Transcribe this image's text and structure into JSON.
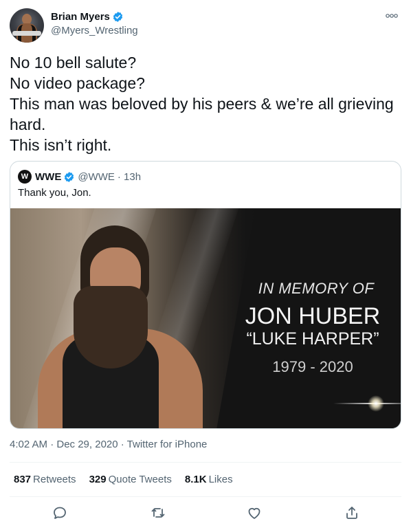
{
  "author": {
    "display_name": "Brian Myers",
    "handle": "@Myers_Wrestling"
  },
  "tweet": {
    "lines": [
      "No 10 bell salute?",
      "No video package?",
      "This man was beloved by his peers & we’re all grieving",
      "hard.",
      "This isn’t right."
    ]
  },
  "quoted": {
    "display_name": "WWE",
    "handle": "@WWE",
    "time": "· 13h",
    "text": "Thank you, Jon.",
    "media": {
      "line1": "IN MEMORY OF",
      "line2": "JON HUBER",
      "line3": "“LUKE HARPER”",
      "line4": "1979 - 2020"
    }
  },
  "meta": {
    "timestamp": "4:02 AM · Dec 29, 2020 · Twitter for iPhone"
  },
  "stats": {
    "retweets_count": "837",
    "retweets_label": "Retweets",
    "quotes_count": "329",
    "quotes_label": "Quote Tweets",
    "likes_count": "8.1K",
    "likes_label": "Likes"
  },
  "icons": {
    "verified": "verified-badge-icon",
    "more": "more-options-icon",
    "reply": "reply-icon",
    "retweet": "retweet-icon",
    "like": "like-icon",
    "share": "share-icon"
  },
  "colors": {
    "verified_blue": "#1d9bf0",
    "text_primary": "#0f1419",
    "text_secondary": "#536471",
    "border": "#cfd9de"
  }
}
